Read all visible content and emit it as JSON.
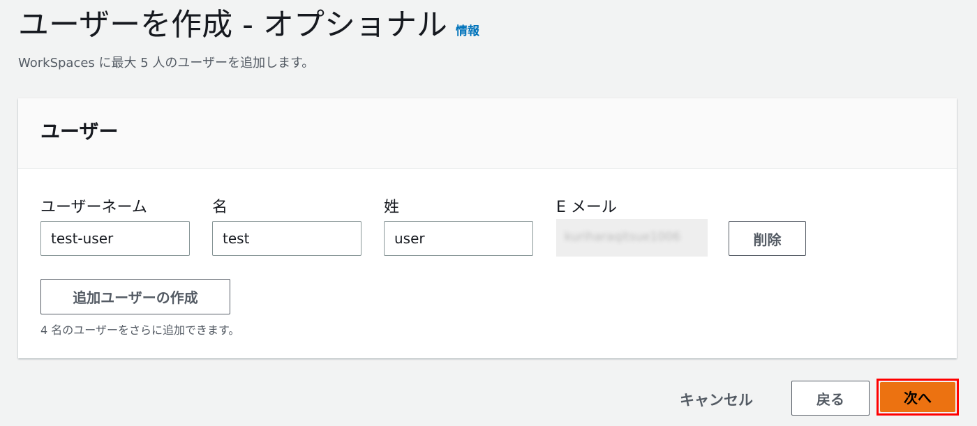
{
  "header": {
    "title": "ユーザーを作成 - オプショナル",
    "info_link": "情報",
    "subtitle": "WorkSpaces に最大 5 人のユーザーを追加します。"
  },
  "panel": {
    "title": "ユーザー",
    "fields": {
      "username_label": "ユーザーネーム",
      "username_value": "test-user",
      "first_name_label": "名",
      "first_name_value": "test",
      "last_name_label": "姓",
      "last_name_value": "user",
      "email_label": "E メール",
      "email_value": "kuriharaqitsue1006"
    },
    "delete_button": "削除",
    "add_user_button": "追加ユーザーの作成",
    "helper_text": "4 名のユーザーをさらに追加できます。"
  },
  "footer": {
    "cancel": "キャンセル",
    "back": "戻る",
    "next": "次へ"
  },
  "colors": {
    "primary": "#ec7211",
    "link": "#0073bb",
    "highlight": "#ff0000",
    "background": "#f2f3f3"
  }
}
